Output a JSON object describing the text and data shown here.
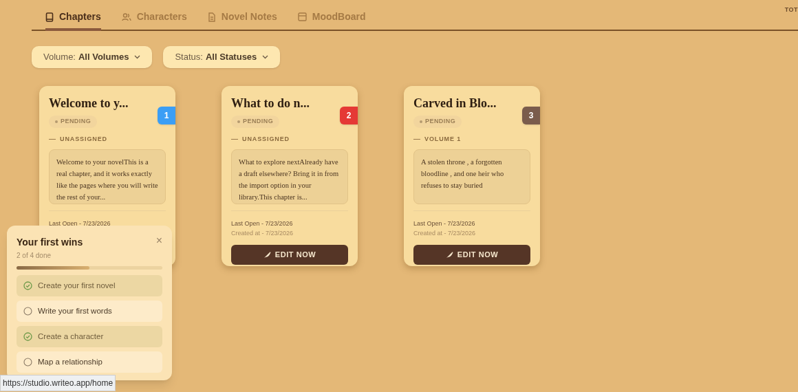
{
  "tabs": [
    {
      "label": "Chapters",
      "selected": true
    },
    {
      "label": "Characters",
      "selected": false
    },
    {
      "label": "Novel Notes",
      "selected": false
    },
    {
      "label": "MoodBoard",
      "selected": false
    }
  ],
  "corner_text": "TOT",
  "filters": [
    {
      "label": "Volume:",
      "value": "All Volumes"
    },
    {
      "label": "Status:",
      "value": "All Statuses"
    }
  ],
  "chapters": [
    {
      "title": "Welcome to y...",
      "status": "PENDING",
      "number": "1",
      "color": "#3b9ef5",
      "volume": "UNASSIGNED",
      "excerpt": "Welcome to your novelThis is a real chapter, and it works exactly like the pages where you will write the rest of your...",
      "last_open": "Last Open - 7/23/2026"
    },
    {
      "title": "What to do n...",
      "status": "PENDING",
      "number": "2",
      "color": "#e53935",
      "volume": "UNASSIGNED",
      "excerpt": "What to explore nextAlready have a draft elsewhere? Bring it in from the import option in your library.This chapter is...",
      "last_open": "Last Open - 7/23/2026",
      "created": "Created at - 7/23/2026",
      "button": "EDIT NOW"
    },
    {
      "title": "Carved in Blo...",
      "status": "PENDING",
      "number": "3",
      "color": "#7a5c4c",
      "volume": "VOLUME 1",
      "excerpt": "A stolen throne , a forgotten bloodline , and one heir who refuses to stay buried",
      "last_open": "Last Open - 7/23/2026",
      "created": "Created at - 7/23/2026",
      "button": "EDIT NOW"
    }
  ],
  "checklist": {
    "title": "Your first wins",
    "close": "×",
    "progress_text": "2 of 4 done",
    "level": 0.5,
    "items": [
      {
        "label": "Create your first novel",
        "checked": true
      },
      {
        "label": "Write your first words",
        "checked": false
      },
      {
        "label": "Create a character",
        "checked": true
      },
      {
        "label": "Map a relationship",
        "checked": false
      }
    ]
  },
  "status_bar": {
    "url": "https://studio.writeo.app/home"
  }
}
